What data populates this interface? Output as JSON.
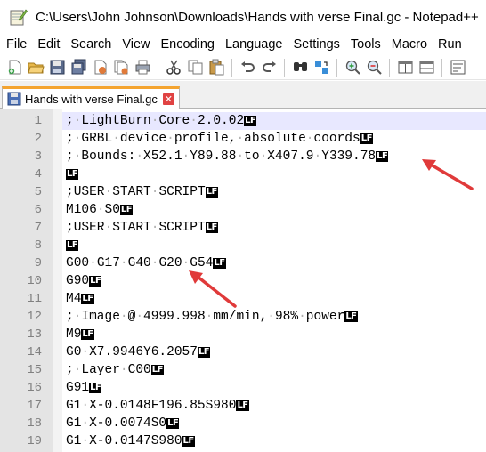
{
  "window": {
    "title": "C:\\Users\\John Johnson\\Downloads\\Hands with verse Final.gc - Notepad++"
  },
  "menu": [
    "File",
    "Edit",
    "Search",
    "View",
    "Encoding",
    "Language",
    "Settings",
    "Tools",
    "Macro",
    "Run"
  ],
  "toolbar": {
    "icons": [
      "new-file-icon",
      "open-file-icon",
      "save-icon",
      "save-all-icon",
      "close-icon",
      "close-all-icon",
      "print-icon",
      "cut-icon",
      "copy-icon",
      "paste-icon",
      "undo-icon",
      "redo-icon",
      "find-icon",
      "replace-icon",
      "zoom-in-icon",
      "zoom-out-icon",
      "sync-vertical-icon",
      "sync-horizontal-icon",
      "word-wrap-icon"
    ]
  },
  "tab": {
    "label": "Hands with verse Final.gc",
    "close_glyph": "✕"
  },
  "eol_marker": "LF",
  "editor": {
    "lines": [
      {
        "n": "1",
        "text": "; LightBurn Core 2.0.02"
      },
      {
        "n": "2",
        "text": "; GRBL device profile, absolute coords"
      },
      {
        "n": "3",
        "text": "; Bounds: X52.1 Y89.88 to X407.9 Y339.78"
      },
      {
        "n": "4",
        "text": ""
      },
      {
        "n": "5",
        "text": ";USER START SCRIPT"
      },
      {
        "n": "6",
        "text": "M106 S0"
      },
      {
        "n": "7",
        "text": ";USER START SCRIPT"
      },
      {
        "n": "8",
        "text": ""
      },
      {
        "n": "9",
        "text": "G00 G17 G40 G20 G54"
      },
      {
        "n": "10",
        "text": "G90"
      },
      {
        "n": "11",
        "text": "M4"
      },
      {
        "n": "12",
        "text": "; Image @ 4999.998 mm/min, 98% power"
      },
      {
        "n": "13",
        "text": "M9"
      },
      {
        "n": "14",
        "text": "G0 X7.9946Y6.2057"
      },
      {
        "n": "15",
        "text": "; Layer C00"
      },
      {
        "n": "16",
        "text": "G91"
      },
      {
        "n": "17",
        "text": "G1 X-0.0148F196.85S980"
      },
      {
        "n": "18",
        "text": "G1 X-0.0074S0"
      },
      {
        "n": "19",
        "text": "G1 X-0.0147S980"
      }
    ]
  },
  "colors": {
    "annotation_arrow": "#e03a3a",
    "tab_accent": "#f4a430",
    "gutter": "#e4e4e4"
  }
}
